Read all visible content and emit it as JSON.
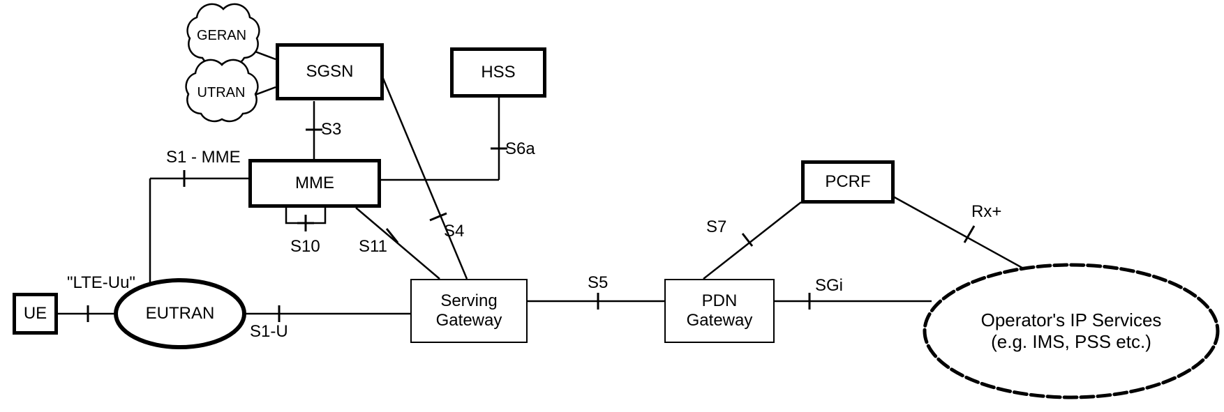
{
  "nodes": {
    "ue": "UE",
    "eutran": "EUTRAN",
    "geran": "GERAN",
    "utran": "UTRAN",
    "sgsn": "SGSN",
    "mme": "MME",
    "hss": "HSS",
    "sgw": "Serving\nGateway",
    "pgw": "PDN\nGateway",
    "pcrf": "PCRF",
    "ops": "Operator's IP Services\n(e.g. IMS, PSS etc.)"
  },
  "links": {
    "lte_uu": "\"LTE-Uu\"",
    "s1_mme": "S1 - MME",
    "s1_u": "S1-U",
    "s3": "S3",
    "s4": "S4",
    "s6a": "S6a",
    "s10": "S10",
    "s11": "S11",
    "s5": "S5",
    "s7": "S7",
    "sgi": "SGi",
    "rx": "Rx+"
  }
}
